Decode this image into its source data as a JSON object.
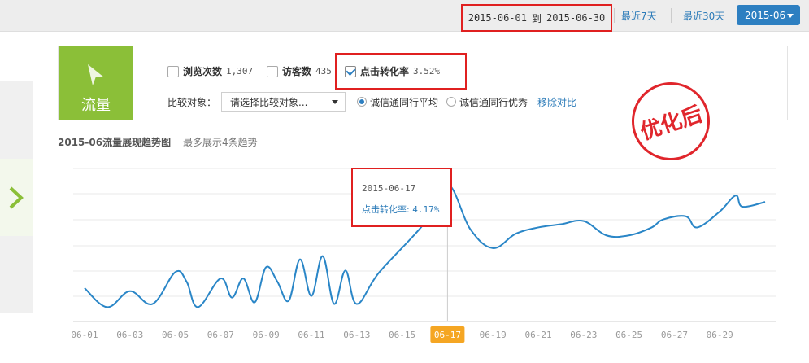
{
  "header": {
    "date_start": "2015-06-01",
    "date_sep": "到",
    "date_end": "2015-06-30",
    "last7": "最近7天",
    "last30": "最近30天",
    "month_select": "2015-06"
  },
  "panel": {
    "tile_label": "流量",
    "metrics": [
      {
        "name": "浏览次数",
        "value": "1,307",
        "checked": false
      },
      {
        "name": "访客数",
        "value": "435",
        "checked": false
      },
      {
        "name": "点击转化率",
        "value": "3.52%",
        "checked": true
      }
    ],
    "compare_label": "比较对象：",
    "compare_placeholder": "请选择比较对象...",
    "radio_avg": "诚信通同行平均",
    "radio_best": "诚信通同行优秀",
    "remove_compare": "移除对比"
  },
  "stamp": "优化后",
  "chart_heading": {
    "title": "2015-06流量展现趋势图",
    "subtitle": "最多展示4条趋势"
  },
  "tooltip": {
    "date": "2015-06-17",
    "label": "点击转化率:",
    "value": "4.17%"
  },
  "colors": {
    "accent": "#2d7fc1",
    "line": "#2a86c7",
    "highlight": "#e02020",
    "tile": "#8bbf38",
    "selected_tick": "#f5a623"
  },
  "chart_data": {
    "type": "line",
    "series": [
      {
        "values": [
          1.05,
          0.45,
          0.95,
          0.55,
          1.55,
          1.25,
          0.45,
          1.35,
          0.75,
          1.35,
          0.6,
          1.7,
          1.25,
          0.65,
          1.95,
          0.8,
          2.05,
          0.55,
          1.6,
          0.55,
          1.55,
          3.1,
          4.3,
          2.9,
          2.3,
          2.75,
          2.95,
          3.05,
          3.15,
          2.7,
          2.7,
          2.95,
          3.2,
          3.3,
          2.95,
          3.45,
          3.95,
          3.6,
          3.75
        ],
        "x": [
          1,
          2,
          3,
          4,
          5,
          5.5,
          6,
          7,
          7.5,
          8,
          8.5,
          9,
          9.5,
          10,
          10.5,
          11,
          11.5,
          12,
          12.5,
          13,
          14,
          16,
          17,
          18,
          19,
          20,
          21,
          22,
          23,
          24,
          25,
          26,
          26.5,
          27.5,
          28,
          29,
          29.7,
          30,
          31
        ]
      }
    ],
    "x_ticks": [
      "06-01",
      "06-03",
      "06-05",
      "06-07",
      "06-09",
      "06-11",
      "06-13",
      "06-15",
      "06-17",
      "06-19",
      "06-21",
      "06-23",
      "06-25",
      "06-27",
      "06-29"
    ],
    "selected_tick": "06-17",
    "highlight_point": {
      "x": 17,
      "y": 4.17
    },
    "grid": true
  }
}
